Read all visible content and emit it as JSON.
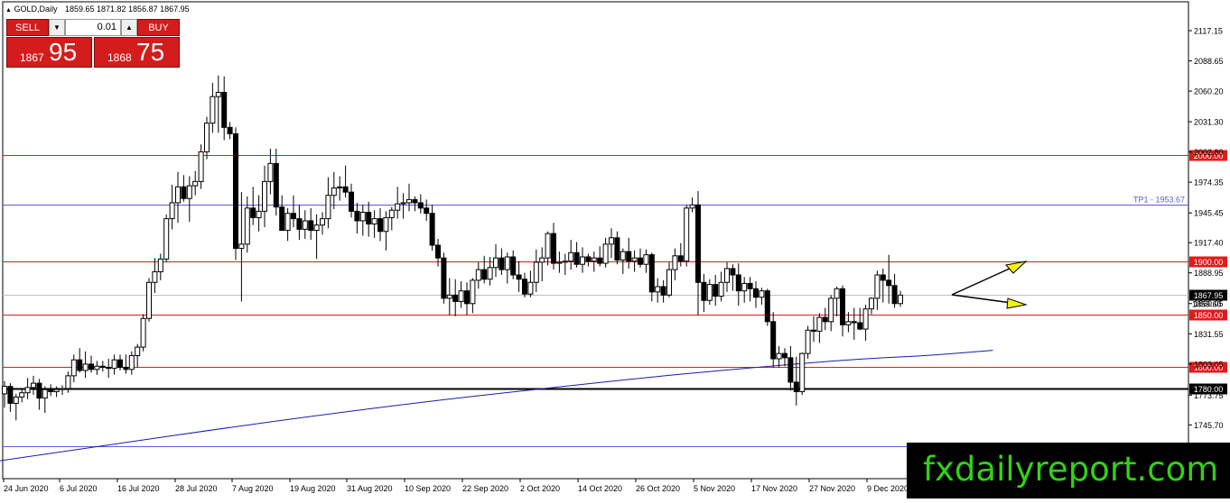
{
  "header": {
    "symbol_label": "GOLD,Daily",
    "ohlc": "1859.65 1871.82 1856.87 1867.95"
  },
  "trade_panel": {
    "sell_label": "SELL",
    "buy_label": "BUY",
    "lot_value": "0.01",
    "sell_price_main": "1867",
    "sell_price_big": "95",
    "buy_price_main": "1868",
    "buy_price_big": "75"
  },
  "watermark": "fxdailyreport.com",
  "colors": {
    "red_level": "#e11b1b",
    "blue_level": "#5b5bd6",
    "ma_line": "#1a1aa8",
    "candle": "#000000",
    "trade_red": "#d41c1c",
    "arrow_fill": "#f2f21a"
  },
  "chart_data": {
    "type": "candlestick",
    "title": "GOLD,Daily",
    "ylim": [
      1720,
      2140
    ],
    "y_ticks": [
      "2117.15",
      "2088.65",
      "2060.20",
      "2031.30",
      "2002.80",
      "1974.35",
      "1945.45",
      "1917.40",
      "1888.95",
      "1860.05",
      "1831.55",
      "1803.05",
      "1773.75",
      "1745.70"
    ],
    "x_ticks": [
      "24 Jun 2020",
      "6 Jul 2020",
      "16 Jul 2020",
      "28 Jul 2020",
      "7 Aug 2020",
      "19 Aug 2020",
      "31 Aug 2020",
      "10 Sep 2020",
      "22 Sep 2020",
      "2 Oct 2020",
      "14 Oct 2020",
      "26 Oct 2020",
      "5 Nov 2020",
      "17 Nov 2020",
      "27 Nov 2020",
      "9 Dec 2020"
    ],
    "horizontal_levels": [
      {
        "value": 2000.0,
        "label": "2000.00",
        "style": "red"
      },
      {
        "value": 1953.67,
        "label": "TP1 - 1953.67",
        "style": "blue"
      },
      {
        "value": 1900.0,
        "label": "1900.00",
        "style": "red"
      },
      {
        "value": 1867.95,
        "label": "1867.95",
        "style": "current"
      },
      {
        "value": 1850.0,
        "label": "1850.00",
        "style": "red"
      },
      {
        "value": 1800.0,
        "label": "1800.00",
        "style": "red"
      },
      {
        "value": 1780.0,
        "label": "1780.00",
        "style": "black"
      },
      {
        "value": 1726.0,
        "label": "",
        "style": "blue"
      }
    ],
    "current_price": 1867.95,
    "secondary_price_label": "1859.60",
    "moving_average": [
      [
        -2,
        1711
      ],
      [
        60,
        1760
      ],
      [
        110,
        1790
      ],
      [
        130,
        1800
      ],
      [
        148,
        1808
      ],
      [
        160,
        1811
      ],
      [
        171,
        1816
      ]
    ],
    "candles": [
      {
        "o": 1775,
        "h": 1787,
        "l": 1762,
        "c": 1782
      },
      {
        "o": 1782,
        "h": 1785,
        "l": 1758,
        "c": 1766
      },
      {
        "o": 1766,
        "h": 1775,
        "l": 1750,
        "c": 1772
      },
      {
        "o": 1772,
        "h": 1780,
        "l": 1767,
        "c": 1776
      },
      {
        "o": 1776,
        "h": 1790,
        "l": 1770,
        "c": 1781
      },
      {
        "o": 1781,
        "h": 1792,
        "l": 1774,
        "c": 1785
      },
      {
        "o": 1785,
        "h": 1789,
        "l": 1760,
        "c": 1771
      },
      {
        "o": 1771,
        "h": 1782,
        "l": 1757,
        "c": 1779
      },
      {
        "o": 1779,
        "h": 1784,
        "l": 1773,
        "c": 1777
      },
      {
        "o": 1777,
        "h": 1782,
        "l": 1772,
        "c": 1779
      },
      {
        "o": 1779,
        "h": 1783,
        "l": 1774,
        "c": 1780
      },
      {
        "o": 1780,
        "h": 1796,
        "l": 1776,
        "c": 1792
      },
      {
        "o": 1792,
        "h": 1812,
        "l": 1786,
        "c": 1807
      },
      {
        "o": 1807,
        "h": 1818,
        "l": 1795,
        "c": 1797
      },
      {
        "o": 1797,
        "h": 1815,
        "l": 1790,
        "c": 1803
      },
      {
        "o": 1803,
        "h": 1811,
        "l": 1795,
        "c": 1798
      },
      {
        "o": 1798,
        "h": 1806,
        "l": 1793,
        "c": 1801
      },
      {
        "o": 1801,
        "h": 1806,
        "l": 1796,
        "c": 1800
      },
      {
        "o": 1800,
        "h": 1808,
        "l": 1790,
        "c": 1799
      },
      {
        "o": 1799,
        "h": 1812,
        "l": 1793,
        "c": 1807
      },
      {
        "o": 1807,
        "h": 1812,
        "l": 1797,
        "c": 1800
      },
      {
        "o": 1800,
        "h": 1812,
        "l": 1794,
        "c": 1798
      },
      {
        "o": 1798,
        "h": 1815,
        "l": 1793,
        "c": 1811
      },
      {
        "o": 1811,
        "h": 1822,
        "l": 1800,
        "c": 1819
      },
      {
        "o": 1819,
        "h": 1850,
        "l": 1815,
        "c": 1846
      },
      {
        "o": 1846,
        "h": 1884,
        "l": 1843,
        "c": 1880
      },
      {
        "o": 1880,
        "h": 1903,
        "l": 1870,
        "c": 1890
      },
      {
        "o": 1890,
        "h": 1907,
        "l": 1882,
        "c": 1902
      },
      {
        "o": 1902,
        "h": 1944,
        "l": 1899,
        "c": 1940
      },
      {
        "o": 1940,
        "h": 1972,
        "l": 1930,
        "c": 1955
      },
      {
        "o": 1955,
        "h": 1984,
        "l": 1936,
        "c": 1970
      },
      {
        "o": 1970,
        "h": 1981,
        "l": 1956,
        "c": 1959
      },
      {
        "o": 1959,
        "h": 1980,
        "l": 1937,
        "c": 1971
      },
      {
        "o": 1971,
        "h": 1985,
        "l": 1962,
        "c": 1975
      },
      {
        "o": 1975,
        "h": 2010,
        "l": 1968,
        "c": 2003
      },
      {
        "o": 2003,
        "h": 2036,
        "l": 1996,
        "c": 2030
      },
      {
        "o": 2030,
        "h": 2068,
        "l": 2021,
        "c": 2055
      },
      {
        "o": 2055,
        "h": 2075,
        "l": 2021,
        "c": 2059
      },
      {
        "o": 2059,
        "h": 2074,
        "l": 2014,
        "c": 2026
      },
      {
        "o": 2026,
        "h": 2031,
        "l": 2015,
        "c": 2020
      },
      {
        "o": 2020,
        "h": 2026,
        "l": 1901,
        "c": 1912
      },
      {
        "o": 1912,
        "h": 1965,
        "l": 1862,
        "c": 1916
      },
      {
        "o": 1916,
        "h": 1961,
        "l": 1908,
        "c": 1950
      },
      {
        "o": 1950,
        "h": 1970,
        "l": 1934,
        "c": 1941
      },
      {
        "o": 1941,
        "h": 1962,
        "l": 1928,
        "c": 1947
      },
      {
        "o": 1947,
        "h": 1990,
        "l": 1932,
        "c": 1975
      },
      {
        "o": 1975,
        "h": 2006,
        "l": 1963,
        "c": 1992
      },
      {
        "o": 1992,
        "h": 2006,
        "l": 1943,
        "c": 1951
      },
      {
        "o": 1951,
        "h": 1962,
        "l": 1929,
        "c": 1929
      },
      {
        "o": 1929,
        "h": 1950,
        "l": 1919,
        "c": 1945
      },
      {
        "o": 1945,
        "h": 1962,
        "l": 1932,
        "c": 1940
      },
      {
        "o": 1940,
        "h": 1953,
        "l": 1920,
        "c": 1930
      },
      {
        "o": 1930,
        "h": 1948,
        "l": 1921,
        "c": 1938
      },
      {
        "o": 1938,
        "h": 1950,
        "l": 1920,
        "c": 1929
      },
      {
        "o": 1929,
        "h": 1944,
        "l": 1902,
        "c": 1934
      },
      {
        "o": 1934,
        "h": 1946,
        "l": 1925,
        "c": 1940
      },
      {
        "o": 1940,
        "h": 1979,
        "l": 1931,
        "c": 1962
      },
      {
        "o": 1962,
        "h": 1984,
        "l": 1949,
        "c": 1969
      },
      {
        "o": 1969,
        "h": 1980,
        "l": 1957,
        "c": 1970
      },
      {
        "o": 1970,
        "h": 1990,
        "l": 1960,
        "c": 1965
      },
      {
        "o": 1965,
        "h": 1973,
        "l": 1941,
        "c": 1947
      },
      {
        "o": 1947,
        "h": 1955,
        "l": 1926,
        "c": 1938
      },
      {
        "o": 1938,
        "h": 1953,
        "l": 1924,
        "c": 1946
      },
      {
        "o": 1946,
        "h": 1956,
        "l": 1923,
        "c": 1935
      },
      {
        "o": 1935,
        "h": 1948,
        "l": 1922,
        "c": 1940
      },
      {
        "o": 1940,
        "h": 1950,
        "l": 1919,
        "c": 1928
      },
      {
        "o": 1928,
        "h": 1947,
        "l": 1910,
        "c": 1941
      },
      {
        "o": 1941,
        "h": 1951,
        "l": 1929,
        "c": 1948
      },
      {
        "o": 1948,
        "h": 1970,
        "l": 1940,
        "c": 1954
      },
      {
        "o": 1954,
        "h": 1964,
        "l": 1940,
        "c": 1955
      },
      {
        "o": 1955,
        "h": 1973,
        "l": 1947,
        "c": 1958
      },
      {
        "o": 1958,
        "h": 1961,
        "l": 1947,
        "c": 1955
      },
      {
        "o": 1955,
        "h": 1963,
        "l": 1945,
        "c": 1950
      },
      {
        "o": 1950,
        "h": 1958,
        "l": 1938,
        "c": 1945
      },
      {
        "o": 1945,
        "h": 1953,
        "l": 1910,
        "c": 1915
      },
      {
        "o": 1915,
        "h": 1921,
        "l": 1895,
        "c": 1903
      },
      {
        "o": 1903,
        "h": 1908,
        "l": 1860,
        "c": 1865
      },
      {
        "o": 1865,
        "h": 1884,
        "l": 1849,
        "c": 1868
      },
      {
        "o": 1868,
        "h": 1883,
        "l": 1848,
        "c": 1862
      },
      {
        "o": 1862,
        "h": 1881,
        "l": 1856,
        "c": 1872
      },
      {
        "o": 1872,
        "h": 1880,
        "l": 1849,
        "c": 1860
      },
      {
        "o": 1860,
        "h": 1884,
        "l": 1851,
        "c": 1882
      },
      {
        "o": 1882,
        "h": 1899,
        "l": 1874,
        "c": 1892
      },
      {
        "o": 1892,
        "h": 1905,
        "l": 1879,
        "c": 1883
      },
      {
        "o": 1883,
        "h": 1904,
        "l": 1877,
        "c": 1894
      },
      {
        "o": 1894,
        "h": 1916,
        "l": 1885,
        "c": 1903
      },
      {
        "o": 1903,
        "h": 1912,
        "l": 1887,
        "c": 1892
      },
      {
        "o": 1892,
        "h": 1908,
        "l": 1879,
        "c": 1904
      },
      {
        "o": 1904,
        "h": 1910,
        "l": 1883,
        "c": 1887
      },
      {
        "o": 1887,
        "h": 1900,
        "l": 1871,
        "c": 1883
      },
      {
        "o": 1883,
        "h": 1889,
        "l": 1866,
        "c": 1869
      },
      {
        "o": 1869,
        "h": 1891,
        "l": 1866,
        "c": 1880
      },
      {
        "o": 1880,
        "h": 1911,
        "l": 1871,
        "c": 1899
      },
      {
        "o": 1899,
        "h": 1913,
        "l": 1881,
        "c": 1903
      },
      {
        "o": 1903,
        "h": 1928,
        "l": 1896,
        "c": 1926
      },
      {
        "o": 1926,
        "h": 1936,
        "l": 1892,
        "c": 1898
      },
      {
        "o": 1898,
        "h": 1909,
        "l": 1889,
        "c": 1899
      },
      {
        "o": 1899,
        "h": 1907,
        "l": 1887,
        "c": 1900
      },
      {
        "o": 1900,
        "h": 1920,
        "l": 1892,
        "c": 1908
      },
      {
        "o": 1908,
        "h": 1918,
        "l": 1894,
        "c": 1897
      },
      {
        "o": 1897,
        "h": 1913,
        "l": 1889,
        "c": 1904
      },
      {
        "o": 1904,
        "h": 1907,
        "l": 1895,
        "c": 1900
      },
      {
        "o": 1900,
        "h": 1909,
        "l": 1890,
        "c": 1903
      },
      {
        "o": 1903,
        "h": 1914,
        "l": 1895,
        "c": 1898
      },
      {
        "o": 1898,
        "h": 1922,
        "l": 1894,
        "c": 1916
      },
      {
        "o": 1916,
        "h": 1931,
        "l": 1903,
        "c": 1922
      },
      {
        "o": 1922,
        "h": 1928,
        "l": 1897,
        "c": 1901
      },
      {
        "o": 1901,
        "h": 1912,
        "l": 1888,
        "c": 1909
      },
      {
        "o": 1909,
        "h": 1922,
        "l": 1893,
        "c": 1900
      },
      {
        "o": 1900,
        "h": 1910,
        "l": 1890,
        "c": 1903
      },
      {
        "o": 1903,
        "h": 1912,
        "l": 1894,
        "c": 1897
      },
      {
        "o": 1897,
        "h": 1911,
        "l": 1889,
        "c": 1906
      },
      {
        "o": 1906,
        "h": 1908,
        "l": 1862,
        "c": 1871
      },
      {
        "o": 1871,
        "h": 1884,
        "l": 1861,
        "c": 1876
      },
      {
        "o": 1876,
        "h": 1882,
        "l": 1861,
        "c": 1868
      },
      {
        "o": 1868,
        "h": 1899,
        "l": 1866,
        "c": 1892
      },
      {
        "o": 1892,
        "h": 1912,
        "l": 1882,
        "c": 1905
      },
      {
        "o": 1905,
        "h": 1917,
        "l": 1895,
        "c": 1900
      },
      {
        "o": 1900,
        "h": 1953,
        "l": 1895,
        "c": 1950
      },
      {
        "o": 1950,
        "h": 1960,
        "l": 1946,
        "c": 1953
      },
      {
        "o": 1953,
        "h": 1966,
        "l": 1849,
        "c": 1880
      },
      {
        "o": 1880,
        "h": 1888,
        "l": 1852,
        "c": 1863
      },
      {
        "o": 1863,
        "h": 1883,
        "l": 1859,
        "c": 1878
      },
      {
        "o": 1878,
        "h": 1887,
        "l": 1858,
        "c": 1867
      },
      {
        "o": 1867,
        "h": 1890,
        "l": 1862,
        "c": 1880
      },
      {
        "o": 1880,
        "h": 1899,
        "l": 1871,
        "c": 1893
      },
      {
        "o": 1893,
        "h": 1897,
        "l": 1872,
        "c": 1887
      },
      {
        "o": 1887,
        "h": 1898,
        "l": 1858,
        "c": 1872
      },
      {
        "o": 1872,
        "h": 1885,
        "l": 1861,
        "c": 1879
      },
      {
        "o": 1879,
        "h": 1885,
        "l": 1862,
        "c": 1874
      },
      {
        "o": 1874,
        "h": 1881,
        "l": 1856,
        "c": 1866
      },
      {
        "o": 1866,
        "h": 1875,
        "l": 1859,
        "c": 1872
      },
      {
        "o": 1872,
        "h": 1874,
        "l": 1839,
        "c": 1843
      },
      {
        "o": 1843,
        "h": 1852,
        "l": 1800,
        "c": 1808
      },
      {
        "o": 1808,
        "h": 1820,
        "l": 1800,
        "c": 1813
      },
      {
        "o": 1813,
        "h": 1818,
        "l": 1801,
        "c": 1809
      },
      {
        "o": 1809,
        "h": 1820,
        "l": 1778,
        "c": 1786
      },
      {
        "o": 1786,
        "h": 1810,
        "l": 1764,
        "c": 1777
      },
      {
        "o": 1777,
        "h": 1814,
        "l": 1774,
        "c": 1813
      },
      {
        "o": 1813,
        "h": 1839,
        "l": 1808,
        "c": 1835
      },
      {
        "o": 1835,
        "h": 1848,
        "l": 1824,
        "c": 1834
      },
      {
        "o": 1834,
        "h": 1851,
        "l": 1823,
        "c": 1847
      },
      {
        "o": 1847,
        "h": 1856,
        "l": 1835,
        "c": 1843
      },
      {
        "o": 1843,
        "h": 1868,
        "l": 1834,
        "c": 1865
      },
      {
        "o": 1865,
        "h": 1876,
        "l": 1848,
        "c": 1874
      },
      {
        "o": 1874,
        "h": 1877,
        "l": 1829,
        "c": 1840
      },
      {
        "o": 1840,
        "h": 1852,
        "l": 1833,
        "c": 1843
      },
      {
        "o": 1843,
        "h": 1856,
        "l": 1826,
        "c": 1842
      },
      {
        "o": 1842,
        "h": 1856,
        "l": 1835,
        "c": 1836
      },
      {
        "o": 1836,
        "h": 1859,
        "l": 1825,
        "c": 1855
      },
      {
        "o": 1855,
        "h": 1866,
        "l": 1850,
        "c": 1865
      },
      {
        "o": 1865,
        "h": 1891,
        "l": 1854,
        "c": 1887
      },
      {
        "o": 1887,
        "h": 1893,
        "l": 1861,
        "c": 1882
      },
      {
        "o": 1882,
        "h": 1906,
        "l": 1860,
        "c": 1877
      },
      {
        "o": 1877,
        "h": 1888,
        "l": 1856,
        "c": 1860
      },
      {
        "o": 1860,
        "h": 1872,
        "l": 1857,
        "c": 1868
      }
    ]
  }
}
